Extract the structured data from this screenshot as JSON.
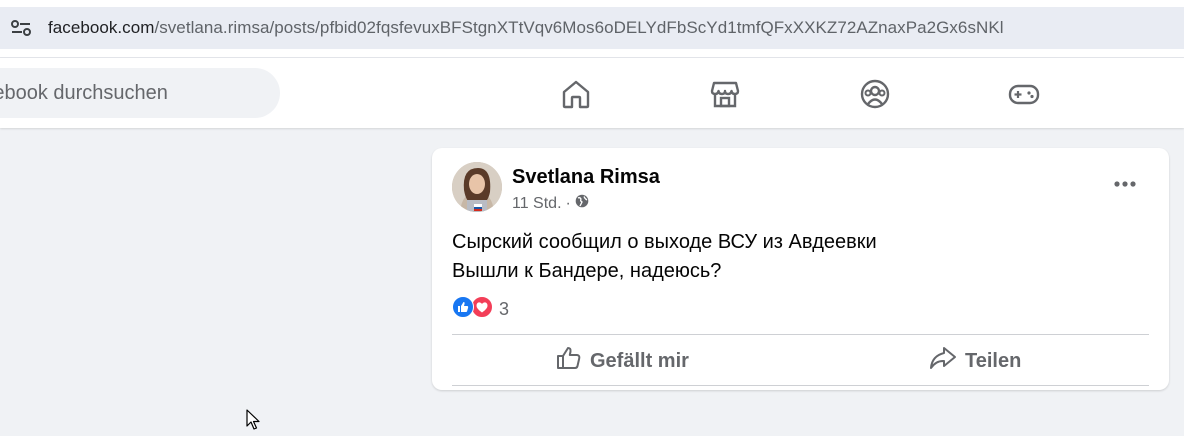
{
  "browser": {
    "url_host": "facebook.com",
    "url_path": "/svetlana.rimsa/posts/pfbid02fqsfevuxBFStgnXTtVqv6Mos6oDELYdFbScYd1tmfQFxXXKZ72AZnaxPa2Gx6sNKl"
  },
  "header": {
    "search_placeholder": "Facebook durchsuchen",
    "nav_icons": [
      "home-icon",
      "marketplace-icon",
      "groups-icon",
      "gaming-icon"
    ]
  },
  "post": {
    "author": "Svetlana Rimsa",
    "time": "11 Std.",
    "separator": "·",
    "privacy_icon": "globe-icon",
    "lines": [
      "Сырский сообщил о выходе ВСУ из Авдеевки",
      "Вышли к Бандере, надеюсь?"
    ],
    "reaction_count": "3",
    "actions": {
      "like": "Gefällt mir",
      "share": "Teilen"
    }
  },
  "colors": {
    "background": "#f0f2f5",
    "like_blue": "#1877f2",
    "love_red": "#f33e58",
    "secondary_text": "#65676b"
  }
}
